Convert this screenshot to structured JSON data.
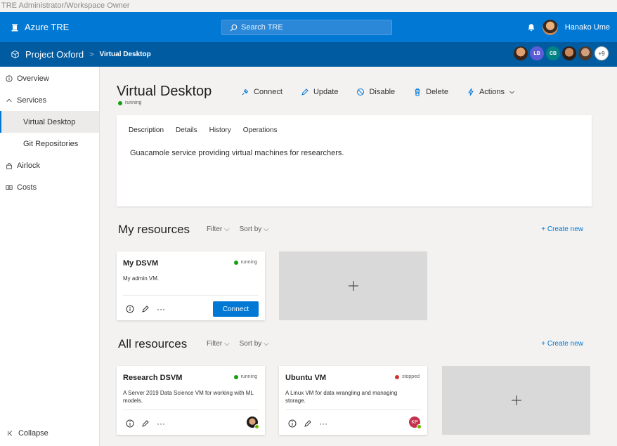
{
  "caption": "TRE Administrator/Workspace Owner",
  "header": {
    "app_title": "Azure TRE",
    "search_placeholder": "Search TRE",
    "user_name": "Hanako Ume"
  },
  "workspace_bar": {
    "workspace_name": "Project Oxford",
    "separator": ">",
    "current": "Virtual Desktop",
    "members": [
      {
        "initials": "",
        "color": "#7a4a2a"
      },
      {
        "initials": "LB",
        "color": "#5c5cd6"
      },
      {
        "initials": "CB",
        "color": "#038387"
      },
      {
        "initials": "",
        "color": "#8e5a3a"
      },
      {
        "initials": "",
        "color": "#5a4a3a"
      }
    ],
    "more_count": "+9"
  },
  "sidebar": {
    "items": [
      {
        "label": "Overview",
        "icon": "info-icon"
      },
      {
        "label": "Services",
        "icon": "chevron-up-icon"
      },
      {
        "label": "Virtual Desktop"
      },
      {
        "label": "Git Repositories"
      },
      {
        "label": "Airlock",
        "icon": "lock-icon"
      },
      {
        "label": "Costs",
        "icon": "money-icon"
      }
    ],
    "collapse_label": "Collapse"
  },
  "service": {
    "title": "Virtual Desktop",
    "status": "running",
    "commands": {
      "connect": "Connect",
      "update": "Update",
      "disable": "Disable",
      "delete": "Delete",
      "actions": "Actions"
    },
    "tabs": [
      "Description",
      "Details",
      "History",
      "Operations"
    ],
    "description": "Guacamole service providing virtual machines for researchers."
  },
  "my_resources": {
    "heading": "My resources",
    "filter": "Filter",
    "sort": "Sort by",
    "create": "+ Create new",
    "cards": [
      {
        "name": "My DSVM",
        "status": "running",
        "description": "My admin VM.",
        "button": "Connect"
      }
    ]
  },
  "all_resources": {
    "heading": "All resources",
    "filter": "Filter",
    "sort": "Sort by",
    "create": "+ Create new",
    "cards": [
      {
        "name": "Research DSVM",
        "status": "running",
        "description": "A Server 2019 Data Science VM for working with ML models.",
        "owner": ""
      },
      {
        "name": "Ubuntu VM",
        "status": "stopped",
        "description": "A Linux VM for data wrangling and managing storage.",
        "owner": "KP"
      }
    ]
  },
  "colors": {
    "brand": "#0078d4",
    "brand_dark": "#005ba1",
    "running": "#13a10e",
    "stopped": "#d13438"
  }
}
